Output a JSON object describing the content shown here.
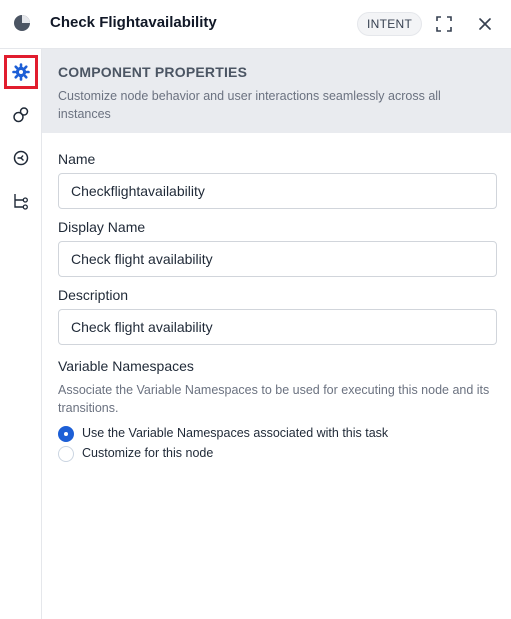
{
  "header": {
    "title": "Check Flightavailability",
    "badge": "INTENT",
    "icons": {
      "node": "pie-chart-icon",
      "expand": "expand-icon",
      "close": "close-icon"
    }
  },
  "rail": {
    "items": [
      {
        "icon": "gear-icon",
        "active": true
      },
      {
        "icon": "connections-icon",
        "active": false
      },
      {
        "icon": "history-icon",
        "active": false
      },
      {
        "icon": "branch-icon",
        "active": false
      }
    ],
    "active_color": "#1d5fd6",
    "highlight_color": "#e11d2e"
  },
  "properties": {
    "title": "COMPONENT PROPERTIES",
    "description": "Customize node behavior and user interactions seamlessly across all instances"
  },
  "fields": {
    "name": {
      "label": "Name",
      "value": "Checkflightavailability"
    },
    "display_name": {
      "label": "Display Name",
      "value": "Check flight availability"
    },
    "description": {
      "label": "Description",
      "value": "Check flight availability"
    }
  },
  "namespaces": {
    "title": "Variable Namespaces",
    "description": "Associate the Variable Namespaces to be used for executing this node and its transitions.",
    "options": [
      {
        "label": "Use the Variable Namespaces associated with this task",
        "selected": true
      },
      {
        "label": "Customize for this node",
        "selected": false
      }
    ]
  }
}
